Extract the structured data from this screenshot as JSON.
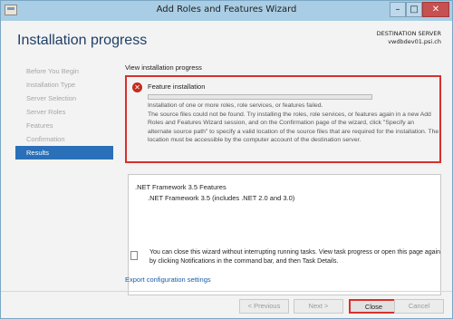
{
  "window": {
    "title": "Add Roles and Features Wizard",
    "controls": {
      "minimize": "–",
      "maximize": "□",
      "close": "✕"
    }
  },
  "header": {
    "page_title": "Installation progress",
    "destination_label": "DESTINATION SERVER",
    "destination_server": "vwdbdev01.psi.ch"
  },
  "sidebar": {
    "items": [
      {
        "label": "Before You Begin",
        "active": false
      },
      {
        "label": "Installation Type",
        "active": false
      },
      {
        "label": "Server Selection",
        "active": false
      },
      {
        "label": "Server Roles",
        "active": false
      },
      {
        "label": "Features",
        "active": false
      },
      {
        "label": "Confirmation",
        "active": false
      },
      {
        "label": "Results",
        "active": true
      }
    ]
  },
  "main": {
    "section_label": "View installation progress",
    "error": {
      "icon": "error-icon",
      "title": "Feature installation",
      "progress_percent": 0,
      "message_line1": "Installation of one or more roles, role services, or features failed.",
      "message_line2": "The source files could not be found. Try installing the roles, role services, or features again in a new Add Roles and Features Wizard session, and on the Confirmation page of the wizard, click \"Specify an alternate source path\" to specify a valid location of the source files that are required for the installation. The location must be accessible by the computer account of the destination server."
    },
    "features": {
      "group": ".NET Framework 3.5 Features",
      "item": ".NET Framework 3.5 (includes .NET 2.0 and 3.0)"
    },
    "info_text": "You can close this wizard without interrupting running tasks. View task progress or open this page again by clicking Notifications in the command bar, and then Task Details.",
    "export_link": "Export configuration settings"
  },
  "footer": {
    "previous": "< Previous",
    "next": "Next >",
    "close": "Close",
    "cancel": "Cancel"
  },
  "colors": {
    "accent": "#2a70b8",
    "error": "#d9302c",
    "title_blue": "#1e3f66",
    "titlebar": "#a9cde4"
  }
}
